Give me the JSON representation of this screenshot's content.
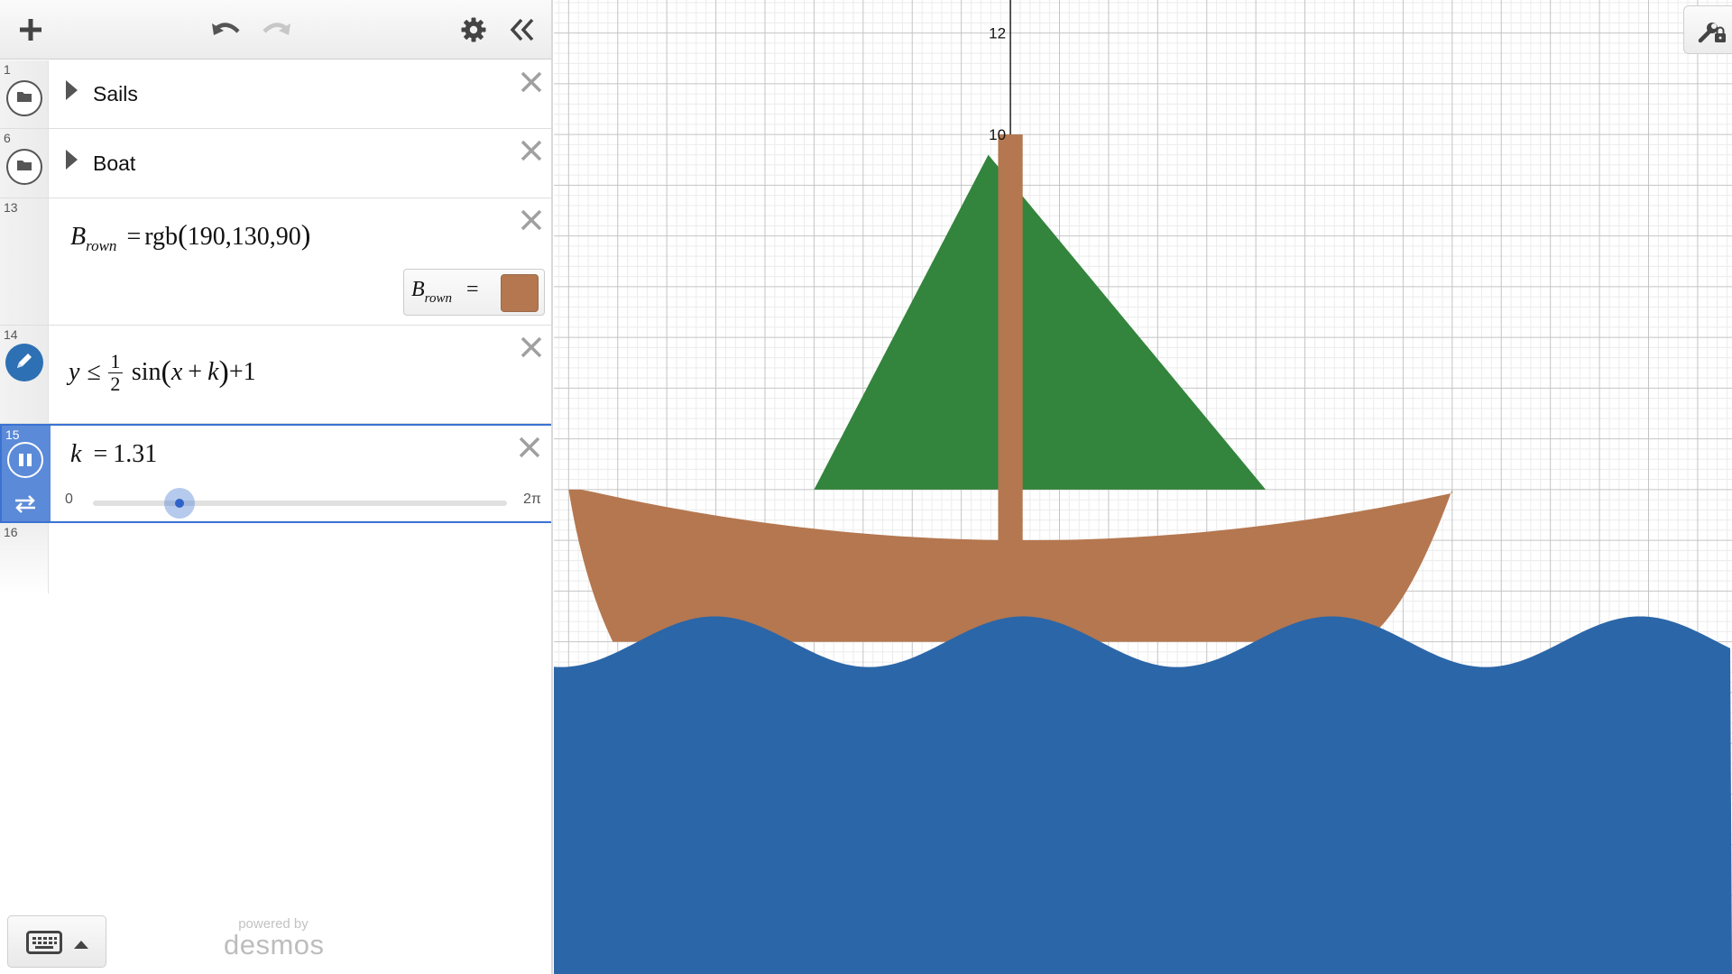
{
  "toolbar": {
    "add_icon": "plus-icon",
    "undo_icon": "undo-icon",
    "redo_icon": "redo-icon",
    "settings_icon": "gear-icon",
    "collapse_icon": "double-chevron-left-icon"
  },
  "expressions": [
    {
      "index": "1",
      "type": "folder",
      "title": "Sails"
    },
    {
      "index": "6",
      "type": "folder",
      "title": "Boat"
    },
    {
      "index": "13",
      "type": "color",
      "lhs": "B",
      "lhs_sub": "rown",
      "rhs_fn": "rgb",
      "rhs_args": "190,130,90",
      "output_color": "#b5774f"
    },
    {
      "index": "14",
      "type": "inequality",
      "lhs": "y",
      "op": "≤",
      "frac_num": "1",
      "frac_den": "2",
      "fn": "sin",
      "arg_x": "x",
      "arg_plus": "+",
      "arg_k": "k",
      "tail": "+1",
      "icon_color": "#2d70b3"
    },
    {
      "index": "15",
      "type": "slider",
      "var": "k",
      "value": "1.31",
      "min": "0",
      "max": "2π",
      "fraction": 0.2085
    },
    {
      "index": "16",
      "type": "empty"
    }
  ],
  "footer": {
    "powered_by": "powered by",
    "brand": "desmos",
    "keyboard_icon": "keyboard-icon"
  },
  "graph": {
    "tick_labels": [
      "12",
      "10"
    ],
    "x_range": [
      -9.3,
      14.7
    ],
    "y_range": [
      -6.55,
      12.65
    ],
    "grid": true,
    "colors": {
      "sail": "#33843c",
      "boat": "#b5774f",
      "water": "#2b66a8",
      "mast": "#b5774f"
    },
    "settings_icon": "wrench-lock-icon"
  }
}
